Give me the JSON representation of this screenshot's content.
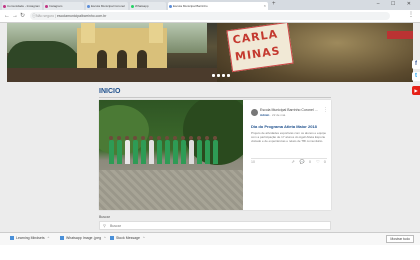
{
  "browser": {
    "tabs": [
      {
        "label": "Comunidade - Instagram",
        "favicon_color": "#c13584"
      },
      {
        "label": "Instagram",
        "favicon_color": "#c13584"
      },
      {
        "label": "Escola Municipal Coronel",
        "favicon_color": "#5b8dd9"
      },
      {
        "label": "Whatsapp",
        "favicon_color": "#25d366"
      },
      {
        "label": "Escola Municipal Barrinho",
        "favicon_color": "#5b8dd9",
        "active": true
      }
    ],
    "new_tab": "+",
    "window_controls": "– ☐ ✕",
    "address": {
      "host": "Não seguro |",
      "url": "escolamunicipalbarrinho.com.br"
    },
    "menu": "⋮"
  },
  "banner": {
    "sign_line1": "CARLA",
    "sign_line2": "MINAS",
    "slide_count": 4
  },
  "social": [
    {
      "icon": "facebook-icon",
      "glyph": "f",
      "color": "#3b5998"
    },
    {
      "icon": "twitter-icon",
      "glyph": "t",
      "color": "#1da1f2"
    },
    {
      "icon": "youtube-icon",
      "glyph": "▶",
      "color": "#e62117"
    }
  ],
  "main": {
    "title": "INICIO",
    "post": {
      "author": "Escola Municipal Barrinho Coronel ...",
      "role": "Admin",
      "date": "· 22 de mai.",
      "options": "⋮",
      "title": "Dia do Programa Atleta Maior 2018",
      "excerpt": "Projeto de atividades esportivas com os alunos e equipe com a participação de 17 alunos do Agell Atleta Esporte visitado e de experiências e relato de TBI comunitário.",
      "views": "10",
      "actions": {
        "share": "⇗",
        "comments": "0",
        "likes": "0"
      }
    },
    "search": {
      "label": "Buscar",
      "placeholder": "Buscar"
    }
  },
  "downloads": {
    "items": [
      {
        "label": "Learning Mindsets"
      },
      {
        "label": "Whatsapp Image .jpeg"
      },
      {
        "label": "Stock Message"
      }
    ],
    "show_all": "Mostrar tudo"
  },
  "colors": {
    "accent": "#1d4f8c",
    "youtube": "#e62117"
  }
}
